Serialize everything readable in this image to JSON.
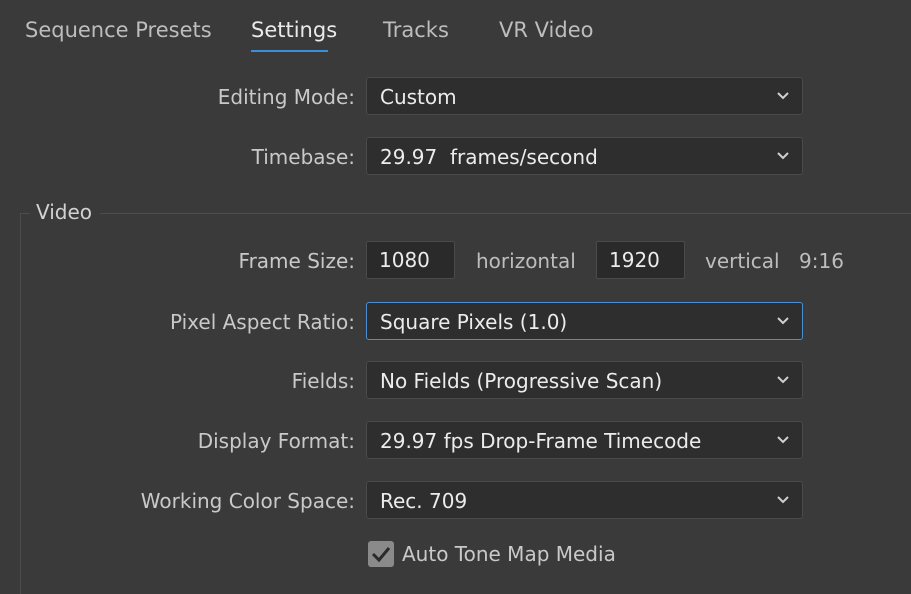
{
  "tabs": [
    {
      "label": "Sequence Presets"
    },
    {
      "label": "Settings"
    },
    {
      "label": "Tracks"
    },
    {
      "label": "VR Video"
    }
  ],
  "active_tab": "Settings",
  "editing_mode": {
    "label": "Editing Mode:",
    "value": "Custom"
  },
  "timebase": {
    "label": "Timebase:",
    "value": "29.97  frames/second"
  },
  "video_group": {
    "title": "Video"
  },
  "frame_size": {
    "label": "Frame Size:",
    "horizontal_value": "1080",
    "horizontal_unit": "horizontal",
    "vertical_value": "1920",
    "vertical_unit": "vertical",
    "aspect": "9:16"
  },
  "pixel_aspect_ratio": {
    "label": "Pixel Aspect Ratio:",
    "value": "Square Pixels (1.0)"
  },
  "fields": {
    "label": "Fields:",
    "value": "No Fields (Progressive Scan)"
  },
  "display_format": {
    "label": "Display Format:",
    "value": "29.97 fps Drop-Frame Timecode"
  },
  "working_color_space": {
    "label": "Working Color Space:",
    "value": "Rec. 709"
  },
  "auto_tone_map": {
    "label": "Auto Tone Map Media",
    "checked": true
  },
  "icons": {
    "dropdown": "chevron-down-icon",
    "checkbox": "checkmark-icon"
  },
  "colors": {
    "background": "#3a3a3a",
    "accent": "#3b8ed8",
    "field_bg": "#2e2e2e"
  }
}
